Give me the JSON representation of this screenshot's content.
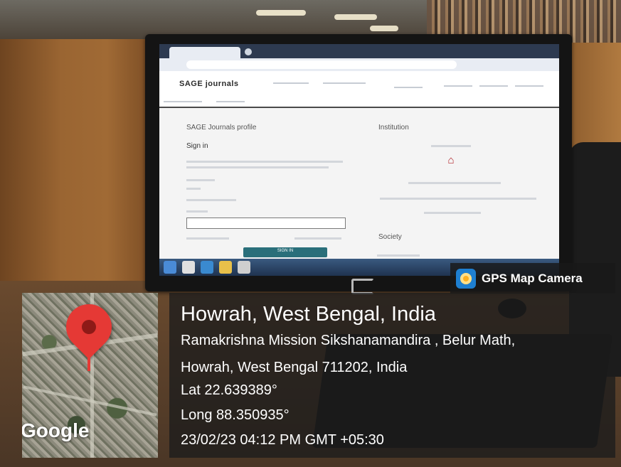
{
  "overlay": {
    "app_name": "GPS Map Camera",
    "map_attribution": "Google",
    "location_title": "Howrah, West Bengal, India",
    "address_line1": "Ramakrishna Mission Sikshanamandira , Belur Math,",
    "address_line2": "Howrah, West Bengal 711202, India",
    "latitude": "Lat 22.639389°",
    "longitude": "Long 88.350935°",
    "timestamp": "23/02/23 04:12 PM GMT +05:30"
  },
  "screen": {
    "logo_text": "SAGE journals",
    "profile_heading": "SAGE Journals profile",
    "institution_heading": "Institution",
    "society_heading": "Society",
    "signin_label": "Sign in",
    "signin_button": "SIGN IN"
  },
  "colors": {
    "pin": "#e53935",
    "overlay_bg": "#1c1c1c",
    "signin_button": "#2a6f7a",
    "institution_icon": "#b1232a"
  },
  "icons": {
    "badge": "gps-map-camera-icon",
    "pin": "location-pin-icon",
    "institution": "bank-icon"
  }
}
